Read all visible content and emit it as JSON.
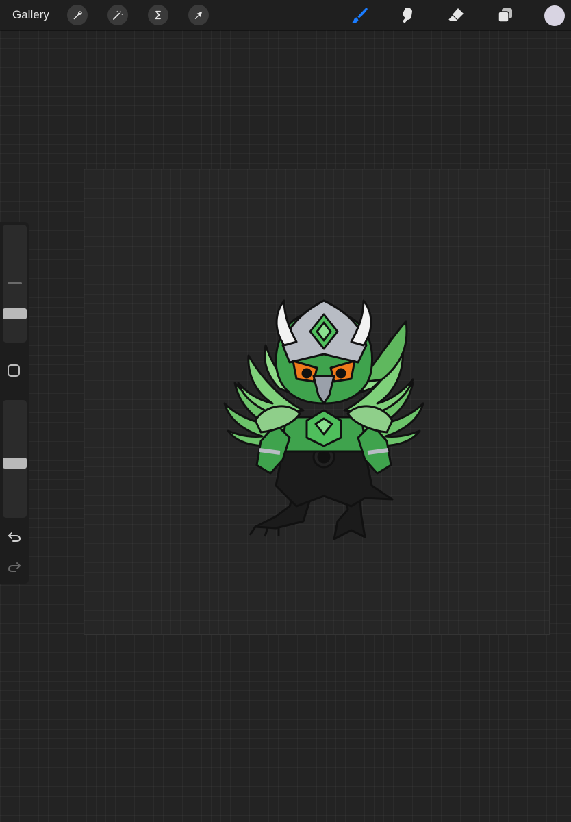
{
  "header": {
    "gallery_label": "Gallery",
    "left_tools": [
      "wrench-icon",
      "magic-wand-icon",
      "selection-icon",
      "transform-arrow-icon"
    ],
    "right_tools": [
      "brush-icon",
      "smudge-icon",
      "eraser-icon",
      "layers-icon"
    ],
    "active_tool": "brush-icon",
    "accent_color": "#1a7cff",
    "current_color": "#d8d4e2"
  },
  "sidebar": {
    "brush_size_level": 0.22,
    "opacity_level": 0.46,
    "undo_icon": "undo-icon",
    "redo_icon": "redo-icon"
  },
  "canvas": {
    "background_color": "#262626",
    "subject_colors": {
      "armor_green": "#3fa34d",
      "wing_green": "#6cc36a",
      "helmet_silver": "#b8bcc4",
      "eye_orange": "#f07a1a",
      "outline": "#111111"
    }
  }
}
